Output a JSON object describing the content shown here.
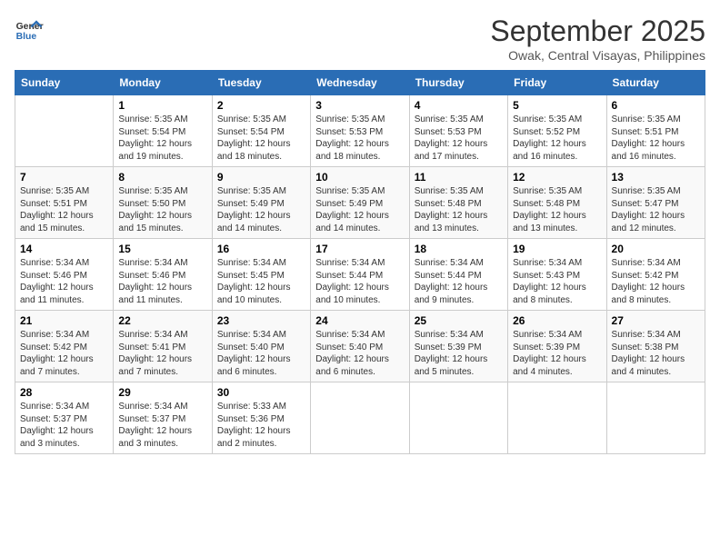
{
  "header": {
    "logo_line1": "General",
    "logo_line2": "Blue",
    "month": "September 2025",
    "location": "Owak, Central Visayas, Philippines"
  },
  "days_of_week": [
    "Sunday",
    "Monday",
    "Tuesday",
    "Wednesday",
    "Thursday",
    "Friday",
    "Saturday"
  ],
  "weeks": [
    [
      {
        "day": "",
        "info": ""
      },
      {
        "day": "1",
        "info": "Sunrise: 5:35 AM\nSunset: 5:54 PM\nDaylight: 12 hours\nand 19 minutes."
      },
      {
        "day": "2",
        "info": "Sunrise: 5:35 AM\nSunset: 5:54 PM\nDaylight: 12 hours\nand 18 minutes."
      },
      {
        "day": "3",
        "info": "Sunrise: 5:35 AM\nSunset: 5:53 PM\nDaylight: 12 hours\nand 18 minutes."
      },
      {
        "day": "4",
        "info": "Sunrise: 5:35 AM\nSunset: 5:53 PM\nDaylight: 12 hours\nand 17 minutes."
      },
      {
        "day": "5",
        "info": "Sunrise: 5:35 AM\nSunset: 5:52 PM\nDaylight: 12 hours\nand 16 minutes."
      },
      {
        "day": "6",
        "info": "Sunrise: 5:35 AM\nSunset: 5:51 PM\nDaylight: 12 hours\nand 16 minutes."
      }
    ],
    [
      {
        "day": "7",
        "info": "Sunrise: 5:35 AM\nSunset: 5:51 PM\nDaylight: 12 hours\nand 15 minutes."
      },
      {
        "day": "8",
        "info": "Sunrise: 5:35 AM\nSunset: 5:50 PM\nDaylight: 12 hours\nand 15 minutes."
      },
      {
        "day": "9",
        "info": "Sunrise: 5:35 AM\nSunset: 5:49 PM\nDaylight: 12 hours\nand 14 minutes."
      },
      {
        "day": "10",
        "info": "Sunrise: 5:35 AM\nSunset: 5:49 PM\nDaylight: 12 hours\nand 14 minutes."
      },
      {
        "day": "11",
        "info": "Sunrise: 5:35 AM\nSunset: 5:48 PM\nDaylight: 12 hours\nand 13 minutes."
      },
      {
        "day": "12",
        "info": "Sunrise: 5:35 AM\nSunset: 5:48 PM\nDaylight: 12 hours\nand 13 minutes."
      },
      {
        "day": "13",
        "info": "Sunrise: 5:35 AM\nSunset: 5:47 PM\nDaylight: 12 hours\nand 12 minutes."
      }
    ],
    [
      {
        "day": "14",
        "info": "Sunrise: 5:34 AM\nSunset: 5:46 PM\nDaylight: 12 hours\nand 11 minutes."
      },
      {
        "day": "15",
        "info": "Sunrise: 5:34 AM\nSunset: 5:46 PM\nDaylight: 12 hours\nand 11 minutes."
      },
      {
        "day": "16",
        "info": "Sunrise: 5:34 AM\nSunset: 5:45 PM\nDaylight: 12 hours\nand 10 minutes."
      },
      {
        "day": "17",
        "info": "Sunrise: 5:34 AM\nSunset: 5:44 PM\nDaylight: 12 hours\nand 10 minutes."
      },
      {
        "day": "18",
        "info": "Sunrise: 5:34 AM\nSunset: 5:44 PM\nDaylight: 12 hours\nand 9 minutes."
      },
      {
        "day": "19",
        "info": "Sunrise: 5:34 AM\nSunset: 5:43 PM\nDaylight: 12 hours\nand 8 minutes."
      },
      {
        "day": "20",
        "info": "Sunrise: 5:34 AM\nSunset: 5:42 PM\nDaylight: 12 hours\nand 8 minutes."
      }
    ],
    [
      {
        "day": "21",
        "info": "Sunrise: 5:34 AM\nSunset: 5:42 PM\nDaylight: 12 hours\nand 7 minutes."
      },
      {
        "day": "22",
        "info": "Sunrise: 5:34 AM\nSunset: 5:41 PM\nDaylight: 12 hours\nand 7 minutes."
      },
      {
        "day": "23",
        "info": "Sunrise: 5:34 AM\nSunset: 5:40 PM\nDaylight: 12 hours\nand 6 minutes."
      },
      {
        "day": "24",
        "info": "Sunrise: 5:34 AM\nSunset: 5:40 PM\nDaylight: 12 hours\nand 6 minutes."
      },
      {
        "day": "25",
        "info": "Sunrise: 5:34 AM\nSunset: 5:39 PM\nDaylight: 12 hours\nand 5 minutes."
      },
      {
        "day": "26",
        "info": "Sunrise: 5:34 AM\nSunset: 5:39 PM\nDaylight: 12 hours\nand 4 minutes."
      },
      {
        "day": "27",
        "info": "Sunrise: 5:34 AM\nSunset: 5:38 PM\nDaylight: 12 hours\nand 4 minutes."
      }
    ],
    [
      {
        "day": "28",
        "info": "Sunrise: 5:34 AM\nSunset: 5:37 PM\nDaylight: 12 hours\nand 3 minutes."
      },
      {
        "day": "29",
        "info": "Sunrise: 5:34 AM\nSunset: 5:37 PM\nDaylight: 12 hours\nand 3 minutes."
      },
      {
        "day": "30",
        "info": "Sunrise: 5:33 AM\nSunset: 5:36 PM\nDaylight: 12 hours\nand 2 minutes."
      },
      {
        "day": "",
        "info": ""
      },
      {
        "day": "",
        "info": ""
      },
      {
        "day": "",
        "info": ""
      },
      {
        "day": "",
        "info": ""
      }
    ]
  ]
}
